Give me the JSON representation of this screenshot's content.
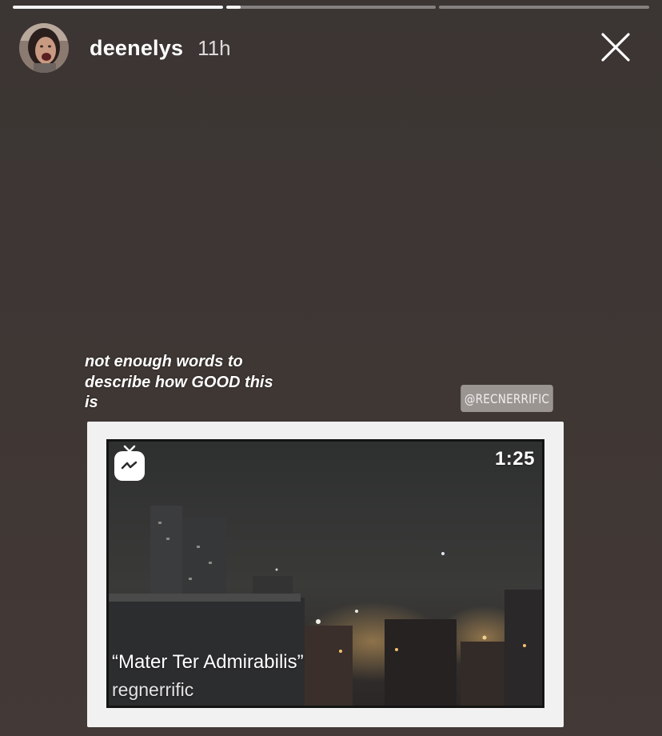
{
  "story": {
    "segments": [
      {
        "progress": 1.0
      },
      {
        "progress": 0.07
      },
      {
        "progress": 0.0
      }
    ]
  },
  "header": {
    "username": "deenelys",
    "time": "11h"
  },
  "icons": {
    "close": "close-icon",
    "avatar": "avatar-image",
    "igtv": "igtv-icon"
  },
  "caption": {
    "text": "not enough words to\ndescribe how GOOD this\nis"
  },
  "mention": {
    "label": "@RECNERRIFIC"
  },
  "video": {
    "duration": "1:25",
    "title": "“Mater Ter Admirabilis”",
    "author": "regnerrific"
  },
  "colors": {
    "background": "#3f3734",
    "card": "#f1f1f1",
    "mention_bg": "#9b9592"
  }
}
